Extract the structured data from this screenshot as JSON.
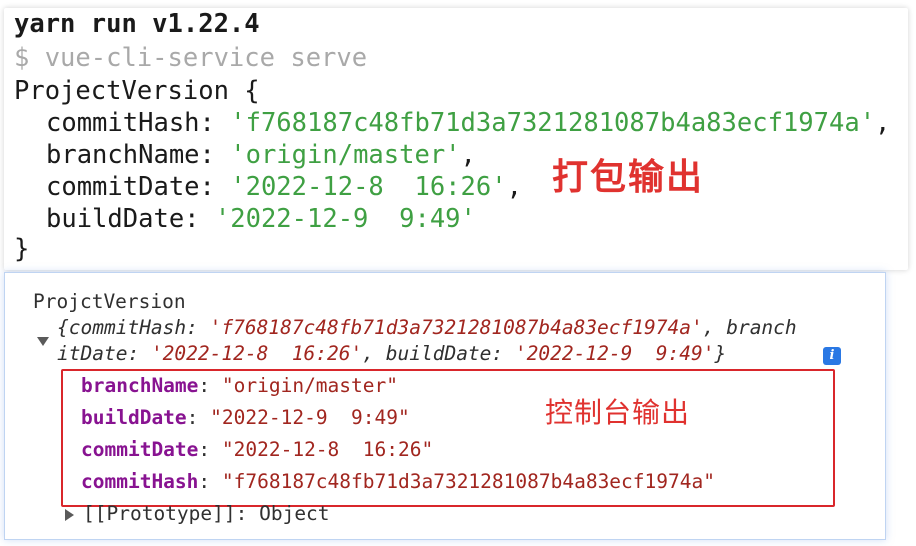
{
  "terminal": {
    "command": "yarn run v1.22.4",
    "subcommand": "$ vue-cli-service serve",
    "object_open": "ProjectVersion {",
    "fields": [
      {
        "key": "commitHash",
        "value": "'f768187c48fb71d3a7321281087b4a83ecf1974a'",
        "sep": ","
      },
      {
        "key": "branchName",
        "value": "'origin/master'",
        "sep": ","
      },
      {
        "key": "commitDate",
        "value": "'2022-12-8  16:26'",
        "sep": ","
      },
      {
        "key": "buildDate",
        "value": "'2022-12-9  9:49'",
        "sep": ""
      }
    ],
    "object_close": "}",
    "annotation": "打包输出"
  },
  "console": {
    "label": "ProjctVersion",
    "summary_line1": [
      {
        "t": "{",
        "c": "plain"
      },
      {
        "t": "commitHash",
        "c": "key"
      },
      {
        "t": ": ",
        "c": "plain"
      },
      {
        "t": "'f768187c48fb71d3a7321281087b4a83ecf1974a'",
        "c": "val"
      },
      {
        "t": ", branch",
        "c": "plain"
      }
    ],
    "summary_line2": [
      {
        "t": "itDate",
        "c": "key"
      },
      {
        "t": ": ",
        "c": "plain"
      },
      {
        "t": "'2022-12-8  16:26'",
        "c": "val"
      },
      {
        "t": ", ",
        "c": "plain"
      },
      {
        "t": "buildDate",
        "c": "key"
      },
      {
        "t": ": ",
        "c": "plain"
      },
      {
        "t": "'2022-12-9  9:49'",
        "c": "val"
      },
      {
        "t": "}",
        "c": "plain"
      }
    ],
    "info_icon": "i",
    "properties": [
      {
        "key": "branchName",
        "value": "\"origin/master\""
      },
      {
        "key": "buildDate",
        "value": "\"2022-12-9  9:49\""
      },
      {
        "key": "commitDate",
        "value": "\"2022-12-8  16:26\""
      },
      {
        "key": "commitHash",
        "value": "\"f768187c48fb71d3a7321281087b4a83ecf1974a\""
      }
    ],
    "prototype": "[[Prototype]]: Object",
    "annotation": "控制台输出"
  },
  "colors": {
    "string_green": "#3fa043",
    "annotation_red": "#e0322f",
    "console_key_purple": "#881391",
    "console_string_red": "#a1261f",
    "info_blue": "#2a78e4"
  }
}
